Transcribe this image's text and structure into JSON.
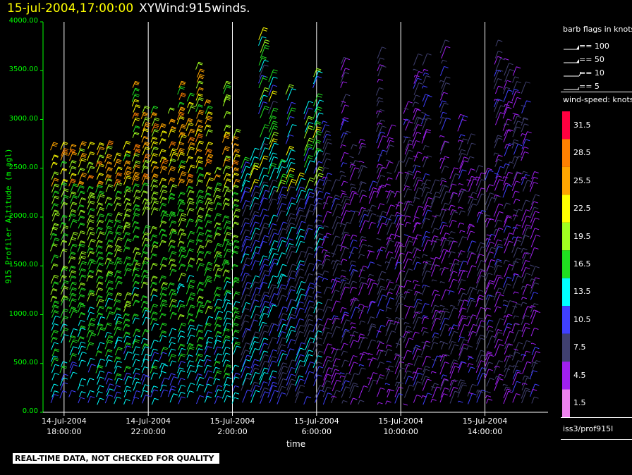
{
  "title": {
    "datetime": "15-jul-2004,17:00:00",
    "product": "XYWind:915winds."
  },
  "footer_note": "REAL-TIME DATA, NOT CHECKED FOR QUALITY",
  "source_label": "iss3/prof915l",
  "colors": {
    "y_axis": "#00ff00",
    "background": "#000000",
    "title_date": "#ffff00"
  },
  "chart_data": {
    "type": "wind-barb time-height",
    "xlabel": "time",
    "ylabel": "915 Profiler Altitude (m agl)",
    "ylim": [
      0,
      4000
    ],
    "yticks": [
      "0.00",
      "500.00",
      "1000.00",
      "1500.00",
      "2000.00",
      "2500.00",
      "3000.00",
      "3500.00",
      "4000.00"
    ],
    "ytick_values": [
      0,
      500,
      1000,
      1500,
      2000,
      2500,
      3000,
      3500,
      4000
    ],
    "xlim_hours": [
      -1,
      23
    ],
    "xticks": [
      {
        "date": "14-Jul-2004",
        "time": "18:00:00",
        "hour": 0
      },
      {
        "date": "14-Jul-2004",
        "time": "22:00:00",
        "hour": 4
      },
      {
        "date": "15-Jul-2004",
        "time": "2:00:00",
        "hour": 8
      },
      {
        "date": "15-Jul-2004",
        "time": "6:00:00",
        "hour": 12
      },
      {
        "date": "15-Jul-2004",
        "time": "10:00:00",
        "hour": 16
      },
      {
        "date": "15-Jul-2004",
        "time": "14:00:00",
        "hour": 20
      }
    ],
    "gridlines_hours": [
      0,
      4,
      8,
      12,
      16,
      20
    ],
    "barb_legend_title": "barb flags in knots",
    "barb_legend": [
      "== 100",
      "== 50",
      "== 10",
      "== 5"
    ],
    "speed_legend_title": "wind-speed: knots",
    "speed_bins": [
      {
        "label": "31.5",
        "value": 31.5,
        "color": "#ff0040"
      },
      {
        "label": "28.5",
        "value": 28.5,
        "color": "#ff8000"
      },
      {
        "label": "25.5",
        "value": 25.5,
        "color": "#ffa500"
      },
      {
        "label": "22.5",
        "value": 22.5,
        "color": "#ffff00"
      },
      {
        "label": "19.5",
        "value": 19.5,
        "color": "#a0ff20"
      },
      {
        "label": "16.5",
        "value": 16.5,
        "color": "#20e020"
      },
      {
        "label": "13.5",
        "value": 13.5,
        "color": "#00ffff"
      },
      {
        "label": "10.5",
        "value": 10.5,
        "color": "#4040ff"
      },
      {
        "label": "7.5",
        "value": 7.5,
        "color": "#404070"
      },
      {
        "label": "4.5",
        "value": 4.5,
        "color": "#a020f0"
      },
      {
        "label": "1.5",
        "value": 1.5,
        "color": "#ee82ee"
      }
    ],
    "legend_placement": "right",
    "grid": "vertical-only"
  }
}
